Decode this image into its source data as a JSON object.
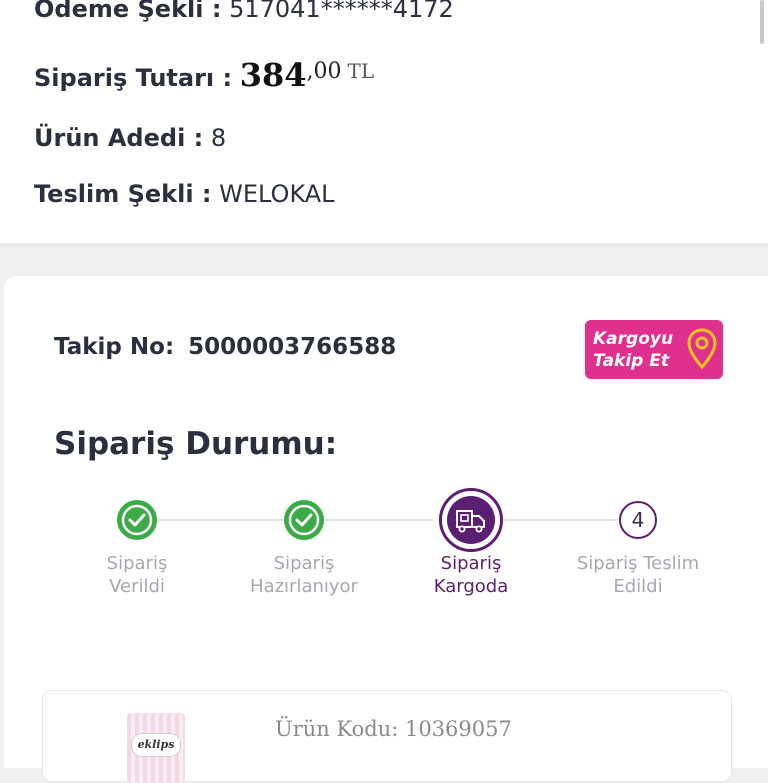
{
  "order_info": {
    "payment_label": "Ödeme Şekli :",
    "payment_value": "517041******4172",
    "amount_label": "Sipariş Tutarı :",
    "amount_int": "384",
    "amount_dec": ",00",
    "amount_currency": "TL",
    "qty_label": "Ürün Adedi :",
    "qty_value": "8",
    "delivery_label": "Teslim Şekli :",
    "delivery_value": "WELOKAL"
  },
  "tracking": {
    "label": "Takip No:",
    "number": "5000003766588",
    "button_line1": "Kargoyu",
    "button_line2": "Takip Et"
  },
  "status": {
    "title": "Sipariş Durumu:",
    "steps": [
      {
        "line1": "Sipariş",
        "line2": "Verildi",
        "state": "done"
      },
      {
        "line1": "Sipariş",
        "line2": "Hazırlanıyor",
        "state": "done"
      },
      {
        "line1": "Sipariş",
        "line2": "Kargoda",
        "state": "current"
      },
      {
        "line1": "Sipariş Teslim",
        "line2": "Edildi",
        "state": "pending",
        "number": "4"
      }
    ]
  },
  "product": {
    "logo": "eklips",
    "code_label": "Ürün Kodu:",
    "code_value": "10369057"
  },
  "colors": {
    "accent_purple": "#5a1f70",
    "success_green": "#3bab45",
    "cargo_pink": "#e0308f",
    "pin_yellow": "#f6c31c"
  }
}
